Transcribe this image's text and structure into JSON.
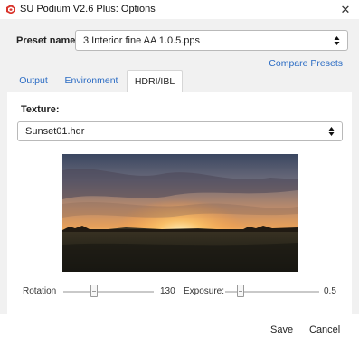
{
  "window": {
    "title": "SU Podium V2.6 Plus: Options",
    "close_glyph": "✕"
  },
  "preset": {
    "label": "Preset name:",
    "value": "3  Interior  fine  AA  1.0.5.pps",
    "compare_link": "Compare Presets"
  },
  "tabs": [
    {
      "label": "Output",
      "active": false
    },
    {
      "label": "Environment",
      "active": false
    },
    {
      "label": "HDRI/IBL",
      "active": true
    }
  ],
  "texture": {
    "label": "Texture:",
    "value": "Sunset01.hdr"
  },
  "sliders": {
    "rotation": {
      "label": "Rotation",
      "value": "130"
    },
    "exposure": {
      "label": "Exposure:",
      "value": "0.5"
    }
  },
  "footer": {
    "save_label": "Save",
    "cancel_label": "Cancel"
  },
  "colors": {
    "link": "#2b6cc4",
    "app_icon": "#d9342b"
  },
  "icons": {
    "app": "sketchup-logo-icon",
    "close": "close-icon",
    "select_arrows": "updown-arrows-icon"
  }
}
